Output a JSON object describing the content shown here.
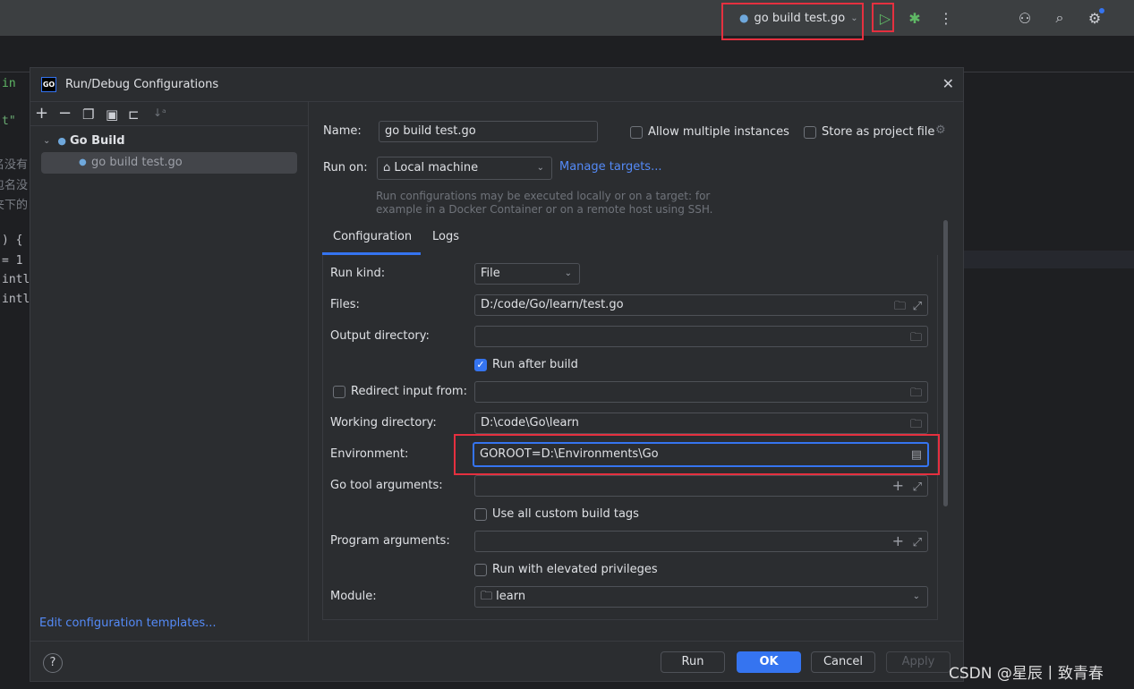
{
  "topbar": {
    "config_name": "go build test.go",
    "icons": [
      "go-config-icon",
      "chevron-down-icon",
      "run-icon",
      "debug-bug-icon",
      "more-vertical-icon",
      "add-user-icon",
      "search-icon",
      "settings-gear-icon"
    ],
    "run_color": "#5fb865",
    "highlight_color": "#e5303f"
  },
  "editor": {
    "lines": [
      "in",
      "t\"",
      "名没有",
      "包名没",
      "夹下的",
      ") {",
      "= 1",
      "intl",
      "intl"
    ]
  },
  "dialog": {
    "title": "Run/Debug Configurations",
    "toolbar_icons": [
      "add-icon",
      "remove-icon",
      "copy-icon",
      "save-icon",
      "new-folder-icon",
      "sort-icon"
    ],
    "tree": {
      "group": "Go Build",
      "item": "go build test.go"
    },
    "edit_templates": "Edit configuration templates...",
    "name_label": "Name:",
    "name_value": "go build test.go",
    "allow_multiple": {
      "label": "Allow multiple instances",
      "checked": false
    },
    "store_project": {
      "label": "Store as project file",
      "checked": false
    },
    "run_on_label": "Run on:",
    "run_on_value": "Local machine",
    "manage_targets": "Manage targets...",
    "hint_line1": "Run configurations may be executed locally or on a target: for",
    "hint_line2": "example in a Docker Container or on a remote host using SSH.",
    "tabs": [
      {
        "label": "Configuration",
        "active": true
      },
      {
        "label": "Logs",
        "active": false
      }
    ],
    "run_kind": {
      "label": "Run kind:",
      "value": "File"
    },
    "files": {
      "label": "Files:",
      "value": "D:/code/Go/learn/test.go"
    },
    "output_dir": {
      "label": "Output directory:",
      "value": ""
    },
    "run_after_build": {
      "label": "Run after build",
      "checked": true
    },
    "redirect_input": {
      "label": "Redirect input from:",
      "checked": false,
      "value": ""
    },
    "working_dir": {
      "label": "Working directory:",
      "value": "D:\\code\\Go\\learn"
    },
    "environment": {
      "label": "Environment:",
      "value": "GOROOT=D:\\Environments\\Go"
    },
    "go_tool_args": {
      "label": "Go tool arguments:",
      "value": ""
    },
    "custom_build_tags": {
      "label": "Use all custom build tags",
      "checked": false
    },
    "program_args": {
      "label": "Program arguments:",
      "value": ""
    },
    "elevated": {
      "label": "Run with elevated privileges",
      "checked": false
    },
    "module": {
      "label": "Module:",
      "value": "learn"
    },
    "buttons": {
      "run": "Run",
      "ok": "OK",
      "cancel": "Cancel",
      "apply": "Apply"
    },
    "help": "?"
  },
  "watermark": "CSDN @星辰丨致青春"
}
